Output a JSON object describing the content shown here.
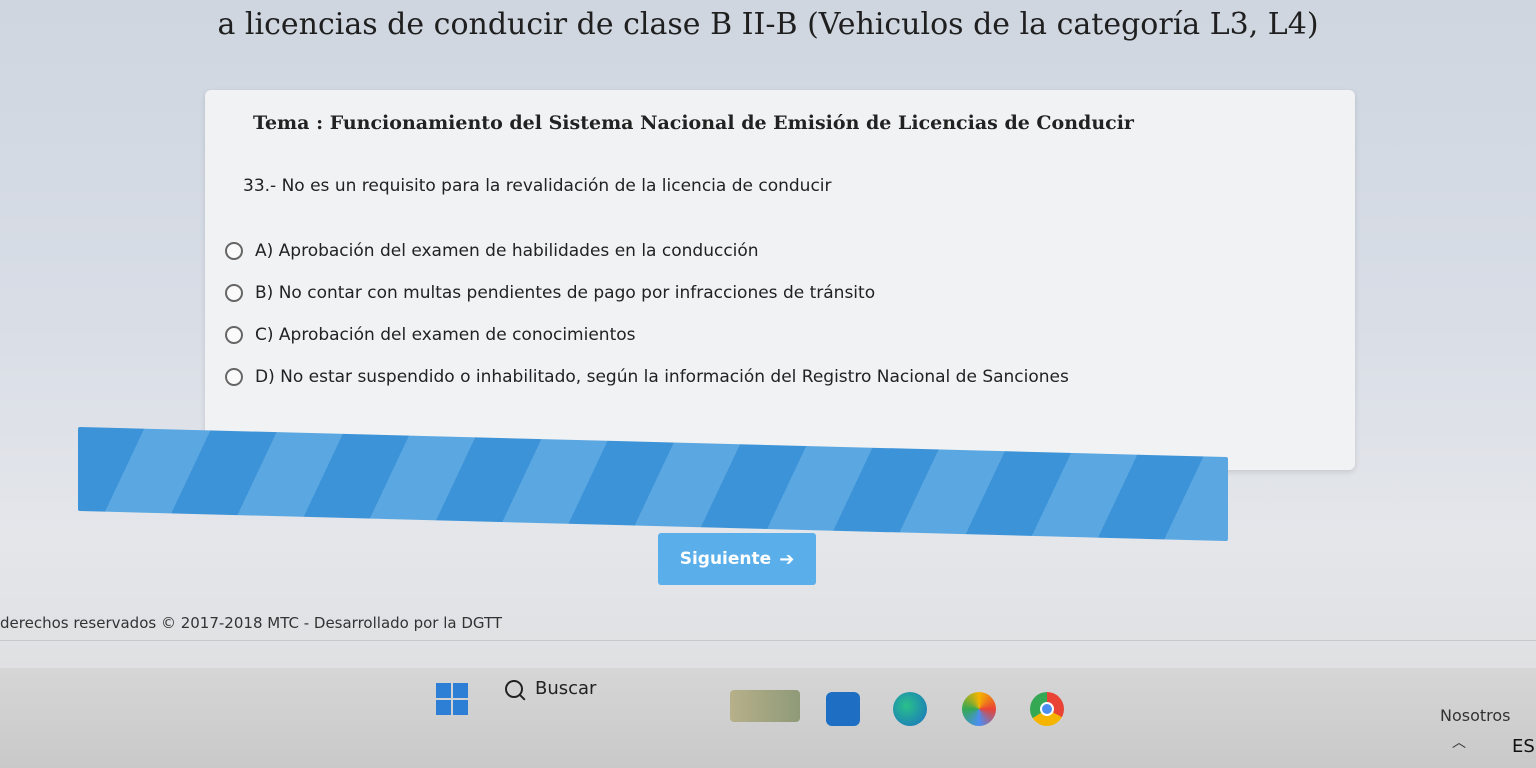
{
  "header": {
    "title": "a licencias de conducir de clase B II-B (Vehiculos de la categoría L3, L4)"
  },
  "question": {
    "topic": "Tema : Funcionamiento del Sistema Nacional de Emisión de Licencias de Conducir",
    "text": "33.- No es un requisito para la revalidación de la licencia de conducir",
    "options": [
      "A) Aprobación del examen de habilidades en la conducción",
      "B) No contar con multas pendientes de pago por infracciones de tránsito",
      "C) Aprobación del examen de conocimientos",
      "D) No estar suspendido o inhabilitado, según la información del Registro Nacional de Sanciones"
    ]
  },
  "navigation": {
    "next_label": "Siguiente"
  },
  "footer": {
    "text": "derechos reservados © 2017-2018 MTC - Desarrollado por la DGTT"
  },
  "taskbar": {
    "search_label": "Buscar",
    "tray_text": "Nosotros",
    "language": "ES"
  },
  "colors": {
    "accent": "#5aaee9",
    "progress": "#3d93d8"
  },
  "icons": [
    "windows-icon",
    "search-icon",
    "weather-icon",
    "store-icon",
    "edge-icon",
    "photos-icon",
    "chrome-icon",
    "chevron-up-icon",
    "arrow-right-icon"
  ]
}
